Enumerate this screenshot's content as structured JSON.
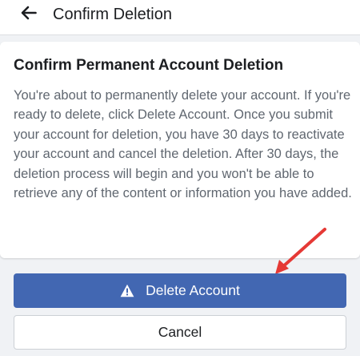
{
  "header": {
    "back_icon": "arrow-left-icon",
    "title": "Confirm Deletion"
  },
  "card": {
    "title": "Confirm Permanent Account Deletion",
    "body": "You're about to permanently delete your account. If you're ready to delete, click Delete Account. Once you submit your account for deletion, you have 30 days to reactivate your account and cancel the deletion. After 30 days, the deletion process will begin and you won't be able to retrieve any of the content or information you have added."
  },
  "actions": {
    "delete_label": "Delete Account",
    "delete_icon": "warning-triangle-icon",
    "cancel_label": "Cancel"
  },
  "colors": {
    "primary": "#4267b2",
    "background": "#f0f2f5",
    "annotation_arrow": "#e53935"
  }
}
